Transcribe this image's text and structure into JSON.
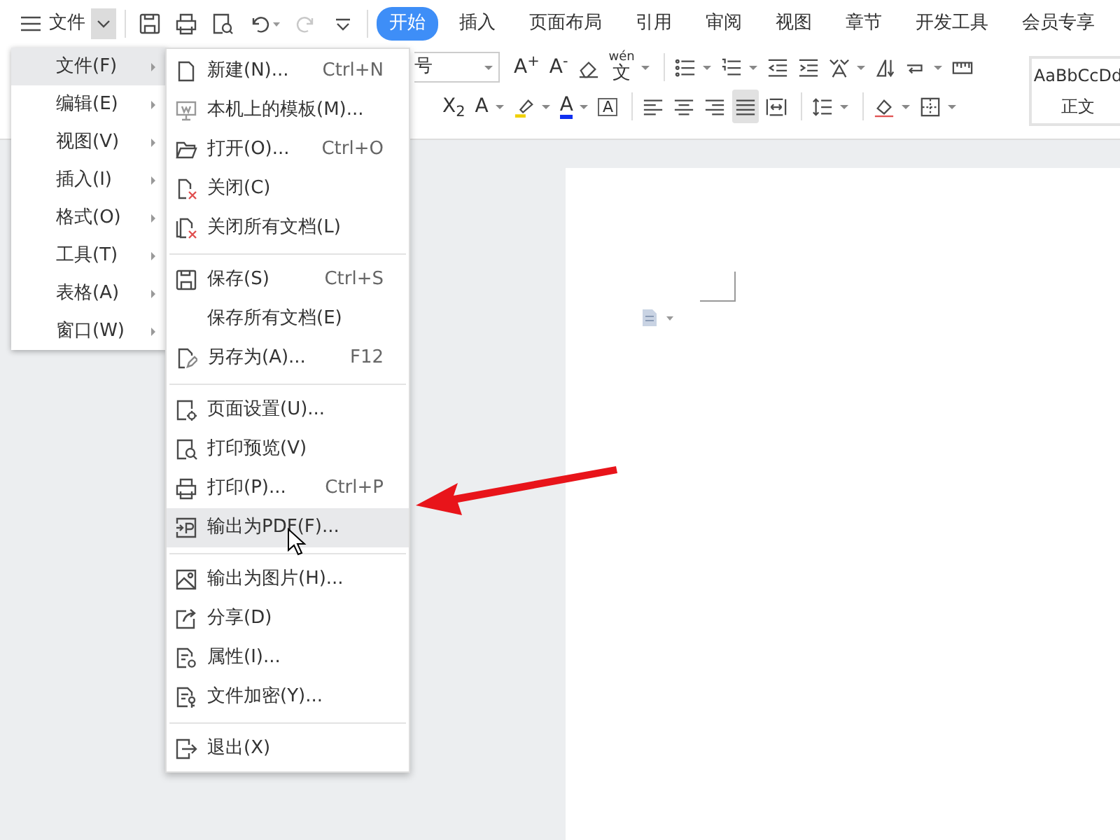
{
  "app_menu": {
    "label": "文件"
  },
  "tabs": [
    {
      "label": "开始",
      "selected": true
    },
    {
      "label": "插入",
      "selected": false
    },
    {
      "label": "页面布局",
      "selected": false
    },
    {
      "label": "引用",
      "selected": false
    },
    {
      "label": "审阅",
      "selected": false
    },
    {
      "label": "视图",
      "selected": false
    },
    {
      "label": "章节",
      "selected": false
    },
    {
      "label": "开发工具",
      "selected": false
    },
    {
      "label": "会员专享",
      "selected": false
    }
  ],
  "ribbon": {
    "font_size": "号",
    "row_1": [
      {
        "kind": "glyph",
        "label": "A$^{+}$",
        "caret": false
      },
      {
        "kind": "glyph",
        "label": "A$^{-}$",
        "caret": false
      },
      {
        "kind": "icon",
        "caret": false
      },
      {
        "kind": "phonetic",
        "ruby": "wén",
        "label": "文",
        "caret": true
      },
      {
        "kind": "divider"
      },
      {
        "kind": "icon",
        "caret": true
      },
      {
        "kind": "icon",
        "caret": true
      },
      {
        "kind": "icon",
        "caret": false
      },
      {
        "kind": "icon",
        "caret": false
      },
      {
        "kind": "icon",
        "caret": true
      },
      {
        "kind": "icon",
        "caret": false
      },
      {
        "kind": "icon",
        "caret": true
      },
      {
        "kind": "icon",
        "caret": false
      }
    ],
    "row_2": [
      {
        "kind": "glyph",
        "label": "X$_{2}$",
        "caret": false
      },
      {
        "kind": "glyph",
        "label": "A",
        "caret": true
      },
      {
        "kind": "icon",
        "caret": true
      },
      {
        "kind": "glyph",
        "label": "A",
        "caret": true
      },
      {
        "kind": "glyph",
        "label": "A",
        "caret": false
      },
      {
        "kind": "divider"
      },
      {
        "kind": "icon",
        "caret": false,
        "selected": false
      },
      {
        "kind": "icon",
        "caret": false,
        "selected": false
      },
      {
        "kind": "icon",
        "caret": false,
        "selected": false
      },
      {
        "kind": "icon",
        "caret": false,
        "selected": true
      },
      {
        "kind": "icon",
        "caret": false,
        "selected": false
      },
      {
        "kind": "divider"
      },
      {
        "kind": "icon",
        "caret": true
      },
      {
        "kind": "divider"
      },
      {
        "kind": "icon",
        "caret": true
      },
      {
        "kind": "icon",
        "caret": true
      }
    ],
    "style_preview": {
      "sample": "AaBbCcDd",
      "name": "正文"
    }
  },
  "main_menu": [
    {
      "label": "文件(F)",
      "selected": true
    },
    {
      "label": "编辑(E)",
      "selected": false
    },
    {
      "label": "视图(V)",
      "selected": false
    },
    {
      "label": "插入(I)",
      "selected": false
    },
    {
      "label": "格式(O)",
      "selected": false
    },
    {
      "label": "工具(T)",
      "selected": false
    },
    {
      "label": "表格(A)",
      "selected": false
    },
    {
      "label": "窗口(W)",
      "selected": false
    }
  ],
  "file_menu": [
    [
      {
        "label": "新建(N)...",
        "shortcut": "Ctrl+N",
        "selected": false
      },
      {
        "label": "本机上的模板(M)...",
        "selected": false
      },
      {
        "label": "打开(O)...",
        "shortcut": "Ctrl+O",
        "selected": false
      },
      {
        "label": "关闭(C)",
        "selected": false
      },
      {
        "label": "关闭所有文档(L)",
        "selected": false
      }
    ],
    [
      {
        "label": "保存(S)",
        "shortcut": "Ctrl+S",
        "selected": false
      },
      {
        "label": "保存所有文档(E)",
        "selected": false
      },
      {
        "label": "另存为(A)...",
        "shortcut": "F12",
        "selected": false
      }
    ],
    [
      {
        "label": "页面设置(U)...",
        "selected": false
      },
      {
        "label": "打印预览(V)",
        "selected": false
      },
      {
        "label": "打印(P)...",
        "shortcut": "Ctrl+P",
        "selected": false
      },
      {
        "label": "输出为PDF(F)...",
        "selected": true
      }
    ],
    [
      {
        "label": "输出为图片(H)...",
        "selected": false
      },
      {
        "label": "分享(D)",
        "selected": false
      },
      {
        "label": "属性(I)...",
        "selected": false
      },
      {
        "label": "文件加密(Y)...",
        "selected": false
      }
    ],
    [
      {
        "label": "退出(X)",
        "selected": false
      }
    ]
  ]
}
